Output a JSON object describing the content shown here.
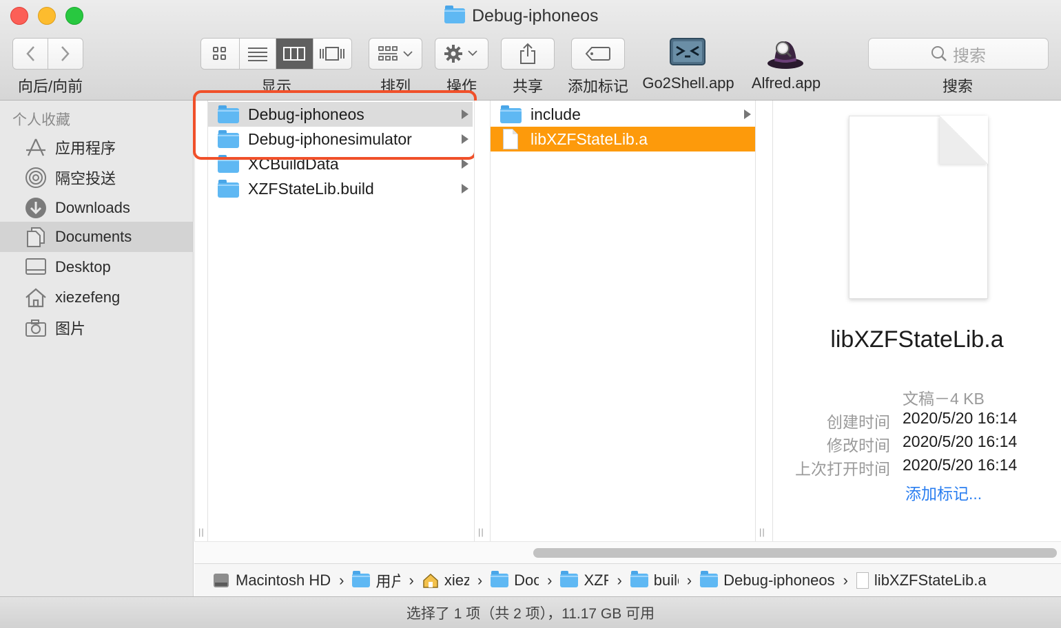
{
  "window": {
    "title": "Debug-iphoneos"
  },
  "toolbar": {
    "nav_label": "向后/向前",
    "view_label": "显示",
    "arrange_label": "排列",
    "action_label": "操作",
    "share_label": "共享",
    "tags_label": "添加标记",
    "app1_label": "Go2Shell.app",
    "app2_label": "Alfred.app",
    "search_placeholder": "搜索",
    "search_label": "搜索"
  },
  "sidebar": {
    "header": "个人收藏",
    "items": [
      {
        "label": "应用程序",
        "icon": "applications-icon"
      },
      {
        "label": "隔空投送",
        "icon": "airdrop-icon"
      },
      {
        "label": "Downloads",
        "icon": "downloads-icon"
      },
      {
        "label": "Documents",
        "icon": "documents-icon",
        "selected": true
      },
      {
        "label": "Desktop",
        "icon": "desktop-icon"
      },
      {
        "label": "xiezefeng",
        "icon": "home-icon"
      },
      {
        "label": "图片",
        "icon": "camera-icon"
      }
    ]
  },
  "column1": {
    "items": [
      {
        "name": "Debug-iphoneos",
        "selected": true
      },
      {
        "name": "Debug-iphonesimulator"
      },
      {
        "name": "XCBuildData"
      },
      {
        "name": "XZFStateLib.build"
      }
    ]
  },
  "column2": {
    "items": [
      {
        "name": "include"
      },
      {
        "name": "libXZFStateLib.a",
        "selected": true
      }
    ]
  },
  "preview": {
    "file_name": "libXZFStateLib.a",
    "kind_size": "文稿－4 KB",
    "created_key": "创建时间",
    "created_val": "2020/5/20 16:14",
    "modified_key": "修改时间",
    "modified_val": "2020/5/20 16:14",
    "opened_key": "上次打开时间",
    "opened_val": "2020/5/20 16:14",
    "add_tags": "添加标记..."
  },
  "pathbar": {
    "crumbs": [
      "Macintosh HD",
      "用户",
      "xiezefeng",
      "Documents",
      "XZFStateLib",
      "build",
      "Debug-iphoneos",
      "libXZFStateLib.a"
    ],
    "display": [
      "Macintosh HD",
      "用户",
      "xiezefeng",
      "Documents",
      "XZFStateLib",
      "build",
      "Debug-iphoneos",
      "libXZFStateLib.a"
    ]
  },
  "status": {
    "text": "选择了 1 项（共 2 项），11.17 GB 可用"
  },
  "colors": {
    "selection_orange": "#fd9a0b",
    "highlight_red": "#f0502a",
    "link_blue": "#2a7ef0",
    "folder_blue": "#5fb8f3"
  }
}
